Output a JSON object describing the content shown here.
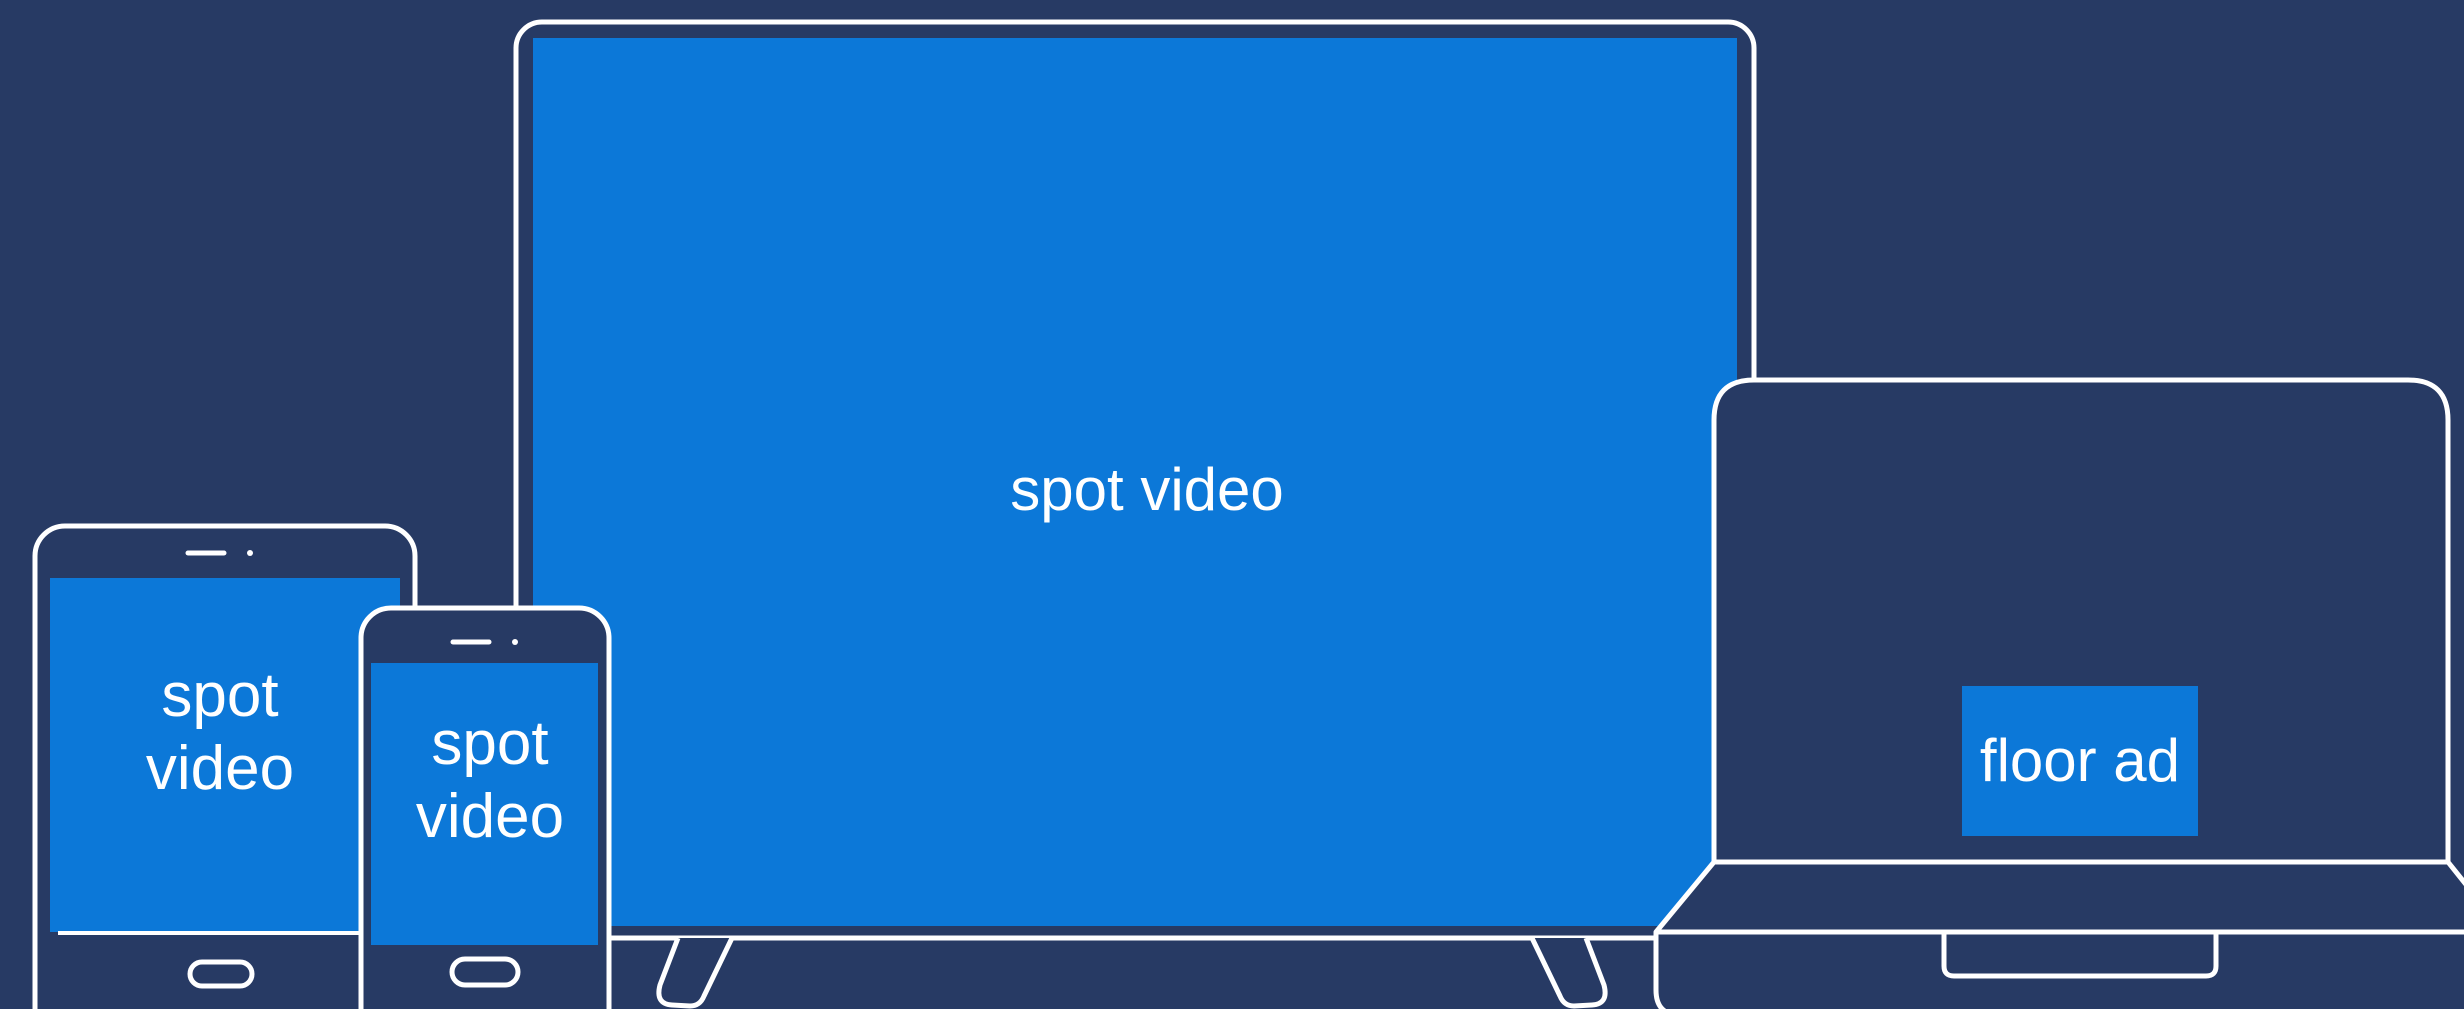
{
  "colors": {
    "background": "#273a64",
    "screen": "#0c78d8",
    "outline": "#ffffff"
  },
  "devices": {
    "tv": {
      "line1": "spot video"
    },
    "tablet": {
      "line1": "spot",
      "line2": "video"
    },
    "phone": {
      "line1": "spot",
      "line2": "video"
    },
    "laptop": {
      "line1": "floor ad"
    }
  }
}
